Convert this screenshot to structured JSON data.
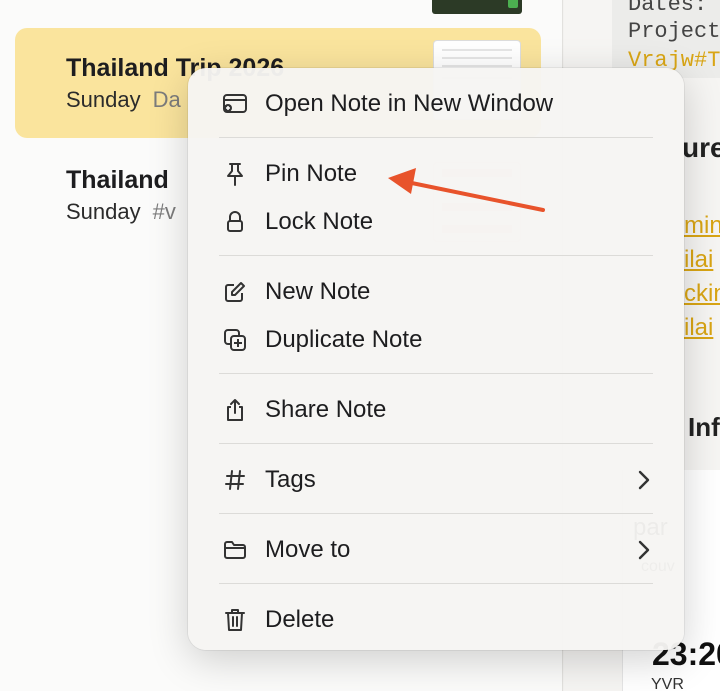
{
  "note_list": {
    "notes": [
      {
        "title": "Thailand Trip 2026",
        "date": "Sunday",
        "tag": "Da"
      },
      {
        "title": "Thailand",
        "date": "Sunday",
        "tag": "#v"
      }
    ]
  },
  "editor": {
    "code_lines": [
      "Dates:",
      "Project",
      "Vrajw#T"
    ],
    "heading": "ure",
    "links": [
      "min",
      "ilai",
      "ckin",
      "ilai"
    ],
    "subheading": "Inf",
    "card_text": "par",
    "card_small": "couv",
    "time": "23:20",
    "airport": "YVR"
  },
  "context_menu": {
    "items": {
      "open_new_window": "Open Note in New Window",
      "pin": "Pin Note",
      "lock": "Lock Note",
      "new_note": "New Note",
      "duplicate": "Duplicate Note",
      "share": "Share Note",
      "tags": "Tags",
      "move_to": "Move to",
      "delete": "Delete"
    }
  },
  "colors": {
    "selected_row": "#fae49d",
    "annotation_arrow": "#e8532b",
    "link": "#d9a514"
  }
}
